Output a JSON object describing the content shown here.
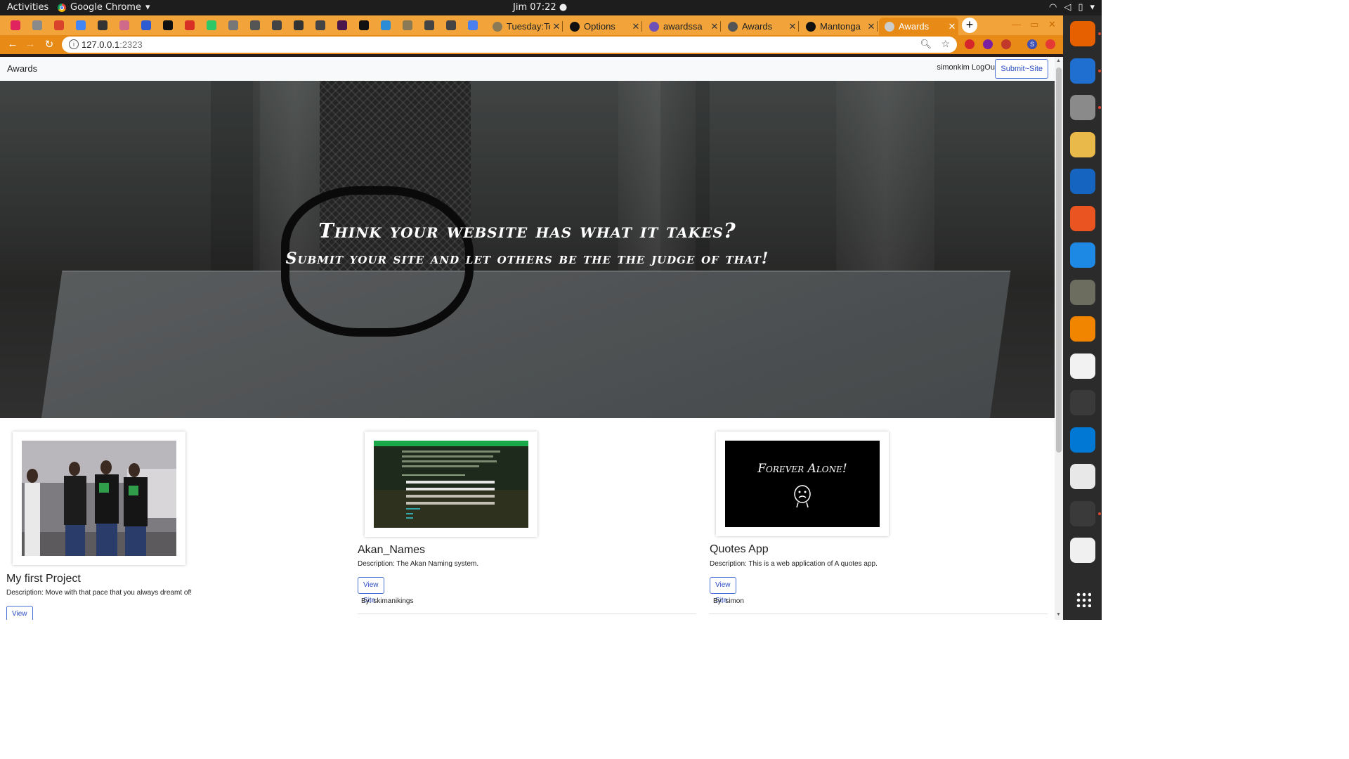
{
  "topbar": {
    "activities": "Activities",
    "app_name": "Google Chrome",
    "app_menu_icon": "chevron-down-icon",
    "clock": "Jim 07:22",
    "system_icons": [
      "wifi-icon",
      "volume-icon",
      "battery-icon",
      "power-menu-icon"
    ]
  },
  "browser": {
    "pinned_tabs": [
      {
        "icon": "youtube-red-icon",
        "color": "#e0245e"
      },
      {
        "icon": "youtube-icon",
        "color": "#8a8a8a"
      },
      {
        "icon": "gallery-icon",
        "color": "#d9432b"
      },
      {
        "icon": "google-icon",
        "color": "#4285f4"
      },
      {
        "icon": "phone-icon",
        "color": "#333333"
      },
      {
        "icon": "shield-icon",
        "color": "#d06a8a"
      },
      {
        "icon": "loop-icon",
        "color": "#2d5bd1"
      },
      {
        "icon": "medium-icon",
        "color": "#111111"
      },
      {
        "icon": "gmail-icon",
        "color": "#d93025"
      },
      {
        "icon": "hackerrank-icon",
        "color": "#2ec866"
      },
      {
        "icon": "frame-icon",
        "color": "#777777"
      },
      {
        "icon": "globe-icon",
        "color": "#555555"
      },
      {
        "icon": "car-icon",
        "color": "#444444"
      },
      {
        "icon": "terminal-icon",
        "color": "#333333"
      },
      {
        "icon": "globe-icon",
        "color": "#444444"
      },
      {
        "icon": "slack-icon",
        "color": "#4a154b"
      },
      {
        "icon": "github-icon",
        "color": "#111111"
      },
      {
        "icon": "compass-icon",
        "color": "#2a8bd6"
      },
      {
        "icon": "pin-icon",
        "color": "#8a7a55"
      },
      {
        "icon": "globe-icon",
        "color": "#444444"
      },
      {
        "icon": "globe-icon",
        "color": "#444444"
      },
      {
        "icon": "docs-icon",
        "color": "#4a7ff0"
      }
    ],
    "tabs": [
      {
        "title": "Tuesday:Te",
        "icon": "pin-icon",
        "color": "#8a7a55",
        "active": false
      },
      {
        "title": "Options",
        "icon": "github-icon",
        "color": "#111111",
        "active": false
      },
      {
        "title": "awardssa",
        "icon": "heroku-icon",
        "color": "#6f4fb8",
        "active": false
      },
      {
        "title": "Awards",
        "icon": "globe-icon",
        "color": "#555555",
        "active": false
      },
      {
        "title": "Mantonga",
        "icon": "github-icon",
        "color": "#111111",
        "active": false
      },
      {
        "title": "Awards",
        "icon": "globe-icon",
        "color": "#cccccc",
        "active": true
      }
    ],
    "new_tab_icon": "plus-icon",
    "window_controls": [
      "minimize-icon",
      "maximize-icon",
      "close-icon"
    ],
    "url_host": "127.0.0.1",
    "url_port": ":2323",
    "extensions": [
      {
        "icon": "extension-red-icon",
        "color": "#d4262c"
      },
      {
        "icon": "extension-purple-icon",
        "color": "#7b1fa2"
      },
      {
        "icon": "extension-pin-icon",
        "color": "#c0392b"
      },
      {
        "icon": "profile-icon",
        "color": "#3f51b5",
        "label": "S"
      },
      {
        "icon": "extension-red2-icon",
        "color": "#e53935"
      }
    ]
  },
  "site": {
    "brand": "Awards",
    "username": "simonkim",
    "logout": "LogOut",
    "submit": "Submit~Site",
    "hero_title": "Think your website has what it takes?",
    "hero_subtitle": "Submit your site and let others be the the judge of that!",
    "projects": [
      {
        "title": "My first Project",
        "description": "Description: Move with that pace that you always dreamt of!",
        "button": "View Site",
        "author": "",
        "image": "group-photo"
      },
      {
        "title": "Akan_Names",
        "description": "Description: The Akan Naming system.",
        "button": "View Site",
        "author": "By: skimanikings",
        "image": "akan-site-screenshot"
      },
      {
        "title": "Quotes App",
        "description": "Description: This is a web application of A quotes app.",
        "button": "View Site",
        "author": "By: simon",
        "image": "forever-alone-image",
        "image_text": "Forever Alone!"
      }
    ]
  },
  "dock": [
    {
      "icon": "firefox-icon",
      "color": "#e66000"
    },
    {
      "icon": "thunderbird-icon",
      "color": "#1f6fd1"
    },
    {
      "icon": "files-icon",
      "color": "#8a8a8a"
    },
    {
      "icon": "rhythmbox-icon",
      "color": "#e9b949"
    },
    {
      "icon": "writer-icon",
      "color": "#1565c0"
    },
    {
      "icon": "software-icon",
      "color": "#e95420"
    },
    {
      "icon": "help-icon",
      "color": "#1e88e5"
    },
    {
      "icon": "gimp-icon",
      "color": "#6d6d5f"
    },
    {
      "icon": "vlc-icon",
      "color": "#f28500"
    },
    {
      "icon": "amazon-icon",
      "color": "#f2f2f2"
    },
    {
      "icon": "terminal-icon",
      "color": "#3a3a3a"
    },
    {
      "icon": "vscode-icon",
      "color": "#0078d4"
    },
    {
      "icon": "screenshot-icon",
      "color": "#e8e8e8"
    },
    {
      "icon": "chrome-icon",
      "color": "#3a3a3a"
    },
    {
      "icon": "text-editor-icon",
      "color": "#f0f0f0"
    }
  ],
  "dock_grid_icon": "show-applications-icon"
}
